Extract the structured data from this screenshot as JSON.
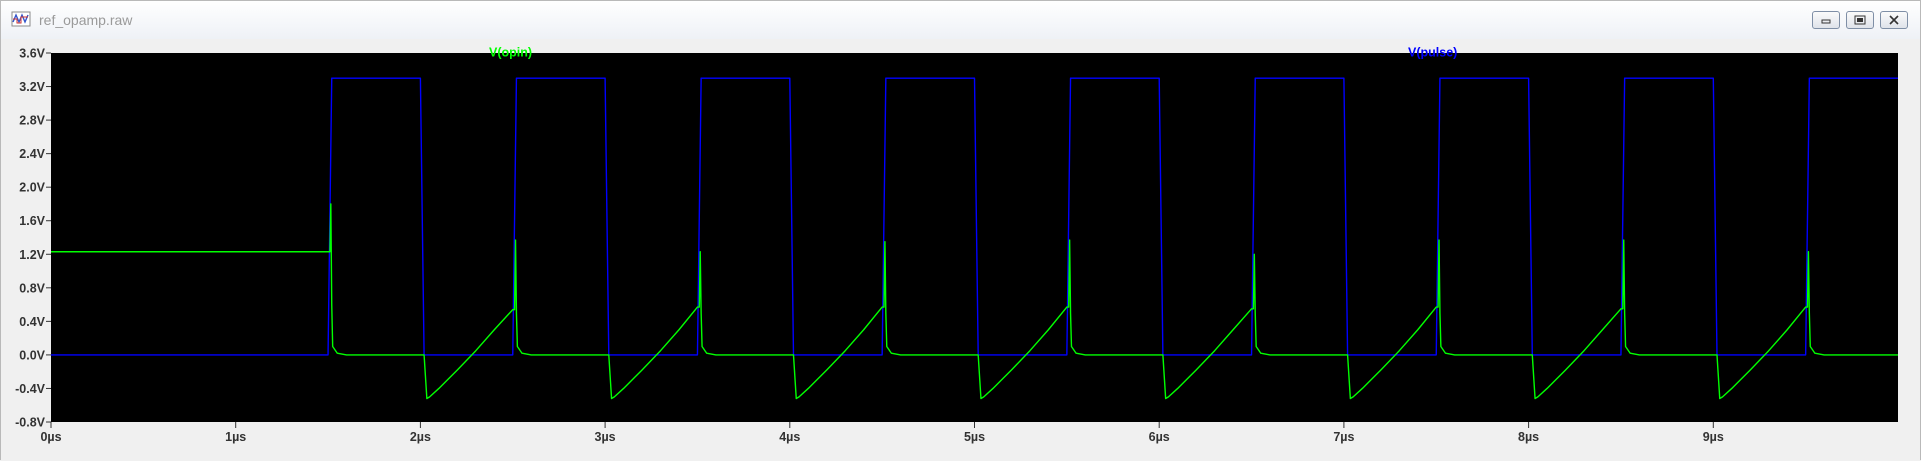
{
  "window": {
    "title": "ref_opamp.raw",
    "controls": [
      "minimize",
      "maximize",
      "close"
    ]
  },
  "colors": {
    "plot_background": "#000000",
    "opin": "#00ff00",
    "pulse": "#0000ff"
  },
  "chart_data": {
    "type": "line",
    "xlabel": "",
    "ylabel": "",
    "xlim": [
      0,
      10
    ],
    "ylim": [
      -0.8,
      3.6
    ],
    "x_unit": "µs",
    "x_ticks": [
      "0µs",
      "1µs",
      "2µs",
      "3µs",
      "4µs",
      "5µs",
      "6µs",
      "7µs",
      "8µs",
      "9µs"
    ],
    "y_ticks": [
      "3.6V",
      "3.2V",
      "2.8V",
      "2.4V",
      "2.0V",
      "1.6V",
      "1.2V",
      "0.8V",
      "0.4V",
      "0.0V",
      "-0.4V",
      "-0.8V"
    ],
    "series": [
      {
        "name": "V(opin)",
        "color": "#00ff00",
        "x": [
          0,
          1.51,
          1.515,
          1.52,
          1.525,
          1.55,
          1.6,
          2.02,
          2.035,
          2.05,
          2.1,
          2.2,
          2.3,
          2.4,
          2.5,
          2.51,
          2.515,
          2.52,
          2.525,
          2.55,
          2.6,
          3.02,
          3.035,
          3.05,
          3.1,
          3.2,
          3.3,
          3.4,
          3.5,
          3.51,
          3.515,
          3.52,
          3.525,
          3.55,
          3.6,
          4.02,
          4.035,
          4.05,
          4.1,
          4.2,
          4.3,
          4.4,
          4.5,
          4.51,
          4.515,
          4.52,
          4.525,
          4.55,
          4.6,
          5.02,
          5.035,
          5.05,
          5.1,
          5.2,
          5.3,
          5.4,
          5.5,
          5.51,
          5.515,
          5.52,
          5.525,
          5.55,
          5.6,
          6.02,
          6.035,
          6.05,
          6.1,
          6.2,
          6.3,
          6.4,
          6.5,
          6.51,
          6.515,
          6.52,
          6.525,
          6.55,
          6.6,
          7.02,
          7.035,
          7.05,
          7.1,
          7.2,
          7.3,
          7.4,
          7.5,
          7.51,
          7.515,
          7.52,
          7.525,
          7.55,
          7.6,
          8.02,
          8.035,
          8.05,
          8.1,
          8.2,
          8.3,
          8.4,
          8.5,
          8.51,
          8.515,
          8.52,
          8.525,
          8.55,
          8.6,
          9.02,
          9.035,
          9.05,
          9.1,
          9.2,
          9.3,
          9.4,
          9.5,
          9.51,
          9.515,
          9.52,
          9.525,
          9.55,
          9.6,
          10.0
        ],
        "values": [
          1.23,
          1.23,
          1.8,
          0.6,
          0.1,
          0.02,
          0.0,
          0.0,
          -0.52,
          -0.5,
          -0.4,
          -0.18,
          0.05,
          0.3,
          0.54,
          0.54,
          1.37,
          0.5,
          0.1,
          0.02,
          0.0,
          0.0,
          -0.52,
          -0.5,
          -0.4,
          -0.18,
          0.05,
          0.3,
          0.57,
          0.57,
          1.23,
          0.5,
          0.1,
          0.02,
          0.0,
          0.0,
          -0.52,
          -0.5,
          -0.4,
          -0.18,
          0.05,
          0.3,
          0.57,
          0.57,
          1.35,
          0.5,
          0.1,
          0.02,
          0.0,
          0.0,
          -0.52,
          -0.5,
          -0.4,
          -0.18,
          0.05,
          0.3,
          0.57,
          0.57,
          1.37,
          0.5,
          0.1,
          0.02,
          0.0,
          0.0,
          -0.52,
          -0.5,
          -0.4,
          -0.18,
          0.05,
          0.3,
          0.55,
          0.55,
          1.2,
          0.5,
          0.1,
          0.02,
          0.0,
          0.0,
          -0.52,
          -0.5,
          -0.4,
          -0.18,
          0.05,
          0.3,
          0.57,
          0.57,
          1.37,
          0.5,
          0.1,
          0.02,
          0.0,
          0.0,
          -0.52,
          -0.5,
          -0.4,
          -0.18,
          0.05,
          0.3,
          0.55,
          0.55,
          1.37,
          0.5,
          0.1,
          0.02,
          0.0,
          0.0,
          -0.52,
          -0.5,
          -0.4,
          -0.18,
          0.05,
          0.3,
          0.57,
          0.57,
          1.23,
          0.5,
          0.1,
          0.02,
          0.0,
          0.0
        ]
      },
      {
        "name": "V(pulse)",
        "color": "#0000ff",
        "x": [
          0,
          1.5,
          1.52,
          2.0,
          2.02,
          2.5,
          2.52,
          3.0,
          3.02,
          3.5,
          3.52,
          4.0,
          4.02,
          4.5,
          4.52,
          5.0,
          5.02,
          5.5,
          5.52,
          6.0,
          6.02,
          6.5,
          6.52,
          7.0,
          7.02,
          7.5,
          7.52,
          8.0,
          8.02,
          8.5,
          8.52,
          9.0,
          9.02,
          9.5,
          9.52,
          10.0
        ],
        "values": [
          0,
          0,
          3.3,
          3.3,
          0,
          0,
          3.3,
          3.3,
          0,
          0,
          3.3,
          3.3,
          0,
          0,
          3.3,
          3.3,
          0,
          0,
          3.3,
          3.3,
          0,
          0,
          3.3,
          3.3,
          0,
          0,
          3.3,
          3.3,
          0,
          0,
          3.3,
          3.3,
          0,
          0,
          3.3,
          3.3
        ]
      }
    ]
  }
}
